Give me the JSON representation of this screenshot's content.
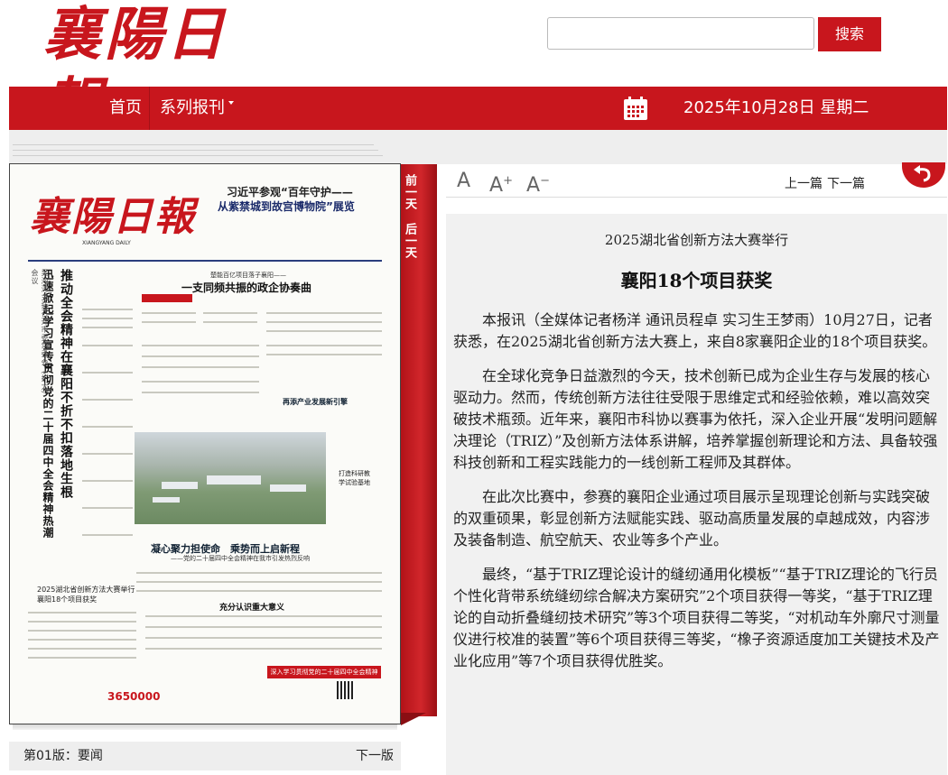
{
  "header": {
    "logo_text": "襄陽日報",
    "search": {
      "placeholder": "",
      "value": "",
      "button_label": "搜索"
    }
  },
  "nav": {
    "items": [
      {
        "label": "首页"
      },
      {
        "label": "系列报刊"
      }
    ],
    "date": "2025年10月28日 星期二",
    "icon": "calendar-icon"
  },
  "paper": {
    "logo": "襄陽日報",
    "subtitle": "XIANGYANG DAILY",
    "headline_top_1": "习近平参观“百年守护——",
    "headline_top_2": "从紫禁城到故宫博物院”展览",
    "lead_vertical": "推动全会精神在襄阳不折不扣落地生根",
    "lead_vertical_2": "迅速掀起学习宣传贯彻党的二十届四中全会精神热潮",
    "lead_vertical_small": "吴海涛主持召开市委常委会（扩大）会议",
    "center_kicker": "楚能百亿项目落子襄阳——",
    "center_title": "一支同频共振的政企协奏曲",
    "side_title": "再添产业发展新引擎",
    "photo_caption": "打造科研教学试验基地",
    "mid_title": "凝心聚力担使命　乘势而上启新程",
    "mid_sub": "——党的二十届四中全会精神在我市引发热烈反响",
    "brief_title": "2025湖北省创新方法大赛举行 襄阳18个项目获奖",
    "bottom_title": "充分认识重大意义",
    "red_strip": "深入学习贯彻党的二十届四中全会精神",
    "circulation": "3650000"
  },
  "ribbon": {
    "prev": "前一天",
    "next": "后一天"
  },
  "toolbar": {
    "font_normal": "A",
    "font_larger": "A",
    "font_smaller": "A",
    "plus": "+",
    "minus": "−",
    "prev_article": "上一篇",
    "next_article": "下一篇"
  },
  "article": {
    "subtitle": "2025湖北省创新方法大赛举行",
    "title": "襄阳18个项目获奖",
    "paragraphs": [
      "本报讯（全媒体记者杨洋 通讯员程卓 实习生王梦雨）10月27日，记者获悉，在2025湖北省创新方法大赛上，来自8家襄阳企业的18个项目获奖。",
      "在全球化竞争日益激烈的今天，技术创新已成为企业生存与发展的核心驱动力。然而，传统创新方法往往受限于思维定式和经验依赖，难以高效突破技术瓶颈。近年来，襄阳市科协以赛事为依托，深入企业开展“发明问题解决理论（TRIZ）”及创新方法体系讲解，培养掌握创新理论和方法、具备较强科技创新和工程实践能力的一线创新工程师及其群体。",
      "在此次比赛中，参赛的襄阳企业通过项目展示呈现理论创新与实践突破的双重硕果，彰显创新方法赋能实践、驱动高质量发展的卓越成效，内容涉及装备制造、航空航天、农业等多个产业。",
      "最终，“基于TRIZ理论设计的缝纫通用化模板”“基于TRIZ理论的飞行员个性化背带系统缝纫综合解决方案研究”2个项目获得一等奖，“基于TRIZ理论的自动折叠缝纫技术研究”等3个项目获得二等奖，“对机动车外廓尺寸测量仪进行校准的装置”等6个项目获得三等奖，“橡子资源适度加工关键技术及产业化应用”等7个项目获得优胜奖。"
    ]
  },
  "pagebar": {
    "current": "第01版：要闻",
    "next": "下一版"
  },
  "colors": {
    "brand_red": "#c8161d",
    "panel_grey": "#f1f1f1"
  }
}
